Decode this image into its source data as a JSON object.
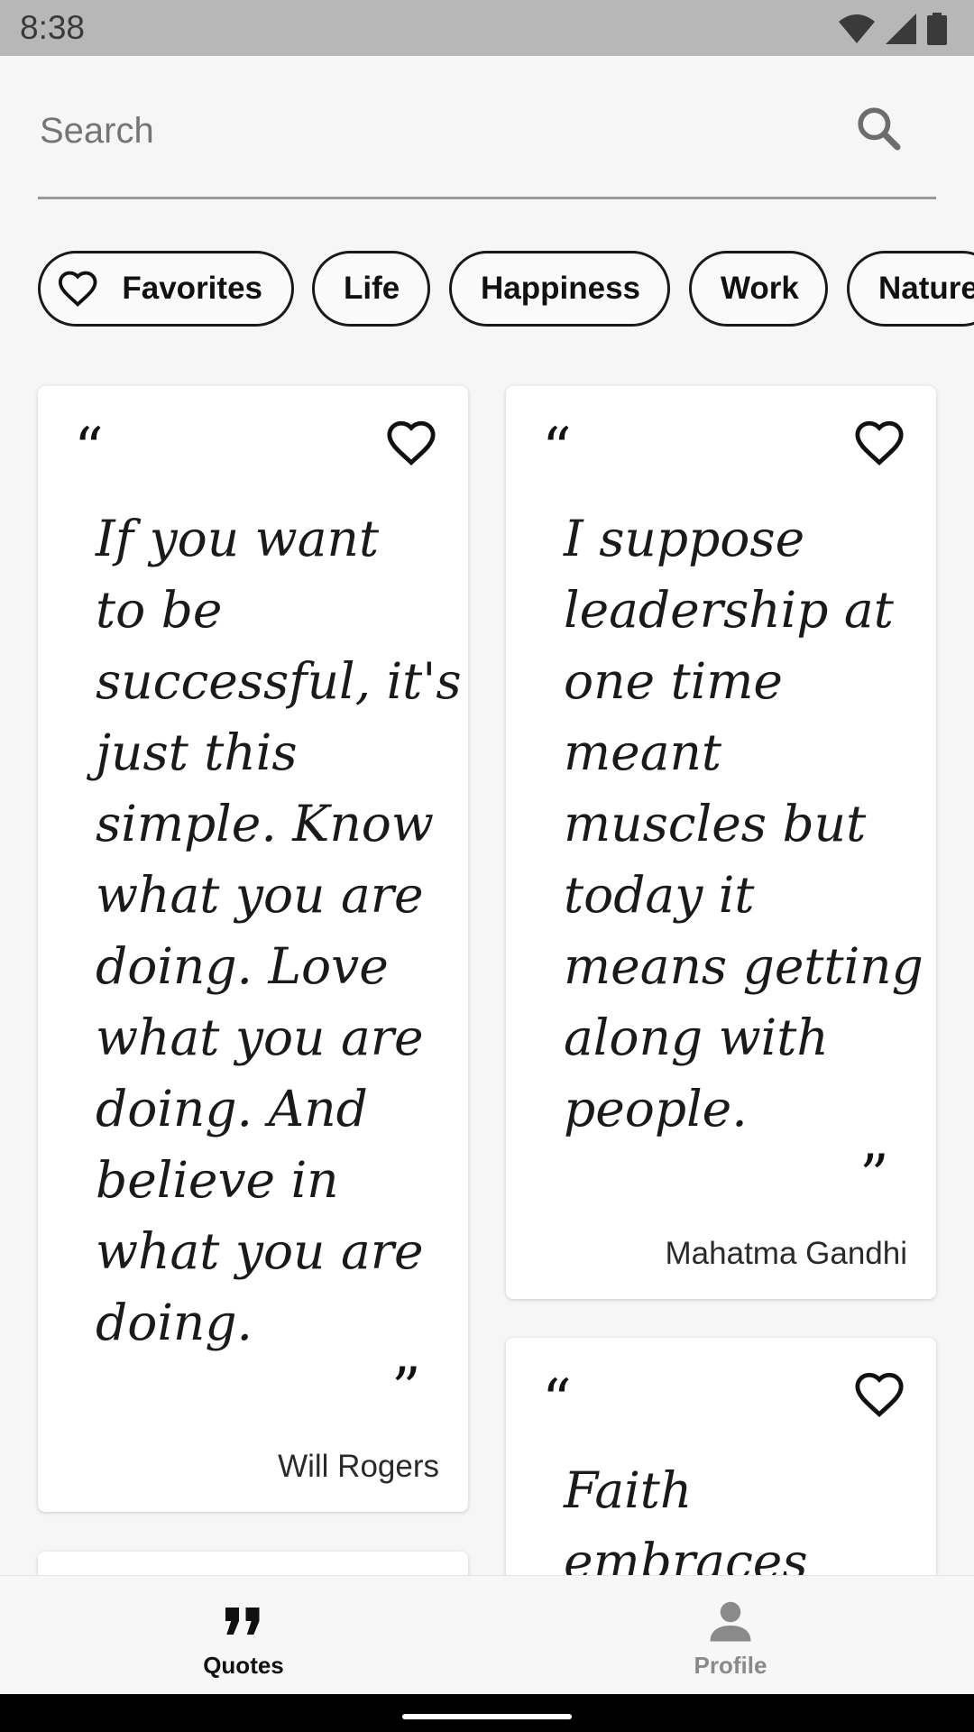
{
  "status": {
    "time": "8:38"
  },
  "search": {
    "placeholder": "Search"
  },
  "chips": [
    {
      "label": "Favorites",
      "icon": "heart-outline-icon"
    },
    {
      "label": "Life"
    },
    {
      "label": "Happiness"
    },
    {
      "label": "Work"
    },
    {
      "label": "Nature"
    }
  ],
  "quotes": [
    {
      "lines": [
        "If you want",
        "to be",
        "successful, it's",
        "just this",
        "simple. Know",
        "what you are",
        "doing. Love",
        "what you are",
        "doing. And",
        "believe in",
        "what you are",
        "doing."
      ],
      "author": "Will Rogers"
    },
    {
      "lines": [
        "I suppose",
        "leadership at",
        "one time",
        "meant",
        "muscles but",
        "today it",
        "means getting",
        "along with",
        "people."
      ],
      "author": "Mahatma Gandhi"
    },
    {
      "lines": [
        "Faith",
        "embraces"
      ],
      "author": ""
    }
  ],
  "nav": {
    "quotes_label": "Quotes",
    "profile_label": "Profile"
  },
  "colors": {
    "accent": "#1a1a1a",
    "inactive": "#8a8a8a"
  }
}
